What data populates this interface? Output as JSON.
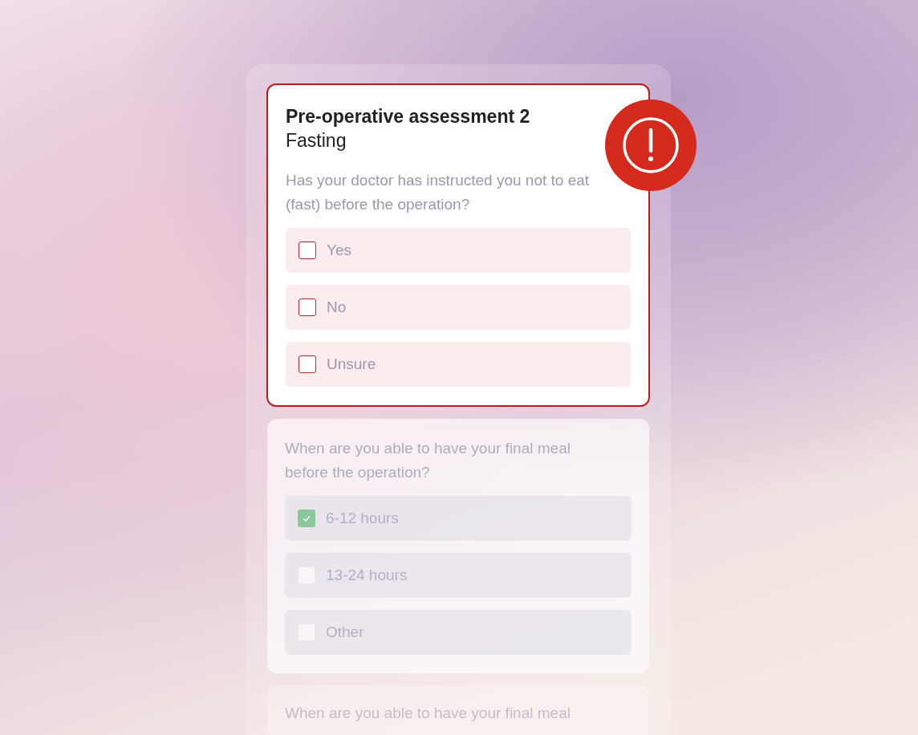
{
  "form": {
    "title": "Pre-operative assessment 2",
    "subtitle": "Fasting",
    "cards": [
      {
        "kind": "error",
        "question": "Has your doctor has instructed you not to eat (fast) before the operation?",
        "options": [
          {
            "label": "Yes",
            "checked": false
          },
          {
            "label": "No",
            "checked": false
          },
          {
            "label": "Unsure",
            "checked": false
          }
        ]
      },
      {
        "kind": "disabled",
        "question": "When are you able to have your final meal before the operation?",
        "options": [
          {
            "label": "6-12 hours",
            "checked": true
          },
          {
            "label": "13-24 hours",
            "checked": false
          },
          {
            "label": "Other",
            "checked": false
          }
        ]
      },
      {
        "kind": "preview",
        "question": "When are you able to have your final meal"
      }
    ]
  }
}
